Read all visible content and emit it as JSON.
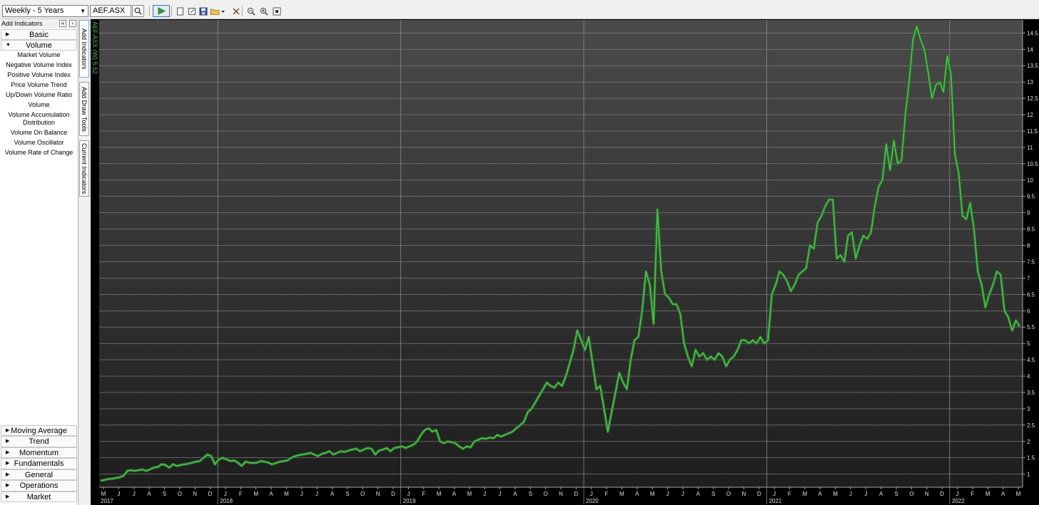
{
  "toolbar": {
    "period_value": "Weekly - 5 Years",
    "symbol_value": "AEF.ASX"
  },
  "left_panel": {
    "header": "Add Indicators",
    "collapse_label": "«",
    "close_label": "‹",
    "top_categories": [
      {
        "label": "Basic",
        "expanded": false
      },
      {
        "label": "Volume",
        "expanded": true
      }
    ],
    "volume_items": [
      "Market Volume",
      "Negative Volume Index",
      "Positive Volume Index",
      "Price Volume Trend",
      "Up/Down Volume Ratio",
      "Volume",
      "Volume Accumulation Distribution",
      "Volume On Balance",
      "Volume Oscillator",
      "Volume Rate of Change"
    ],
    "bottom_categories": [
      "Moving Average",
      "Trend",
      "Momentum",
      "Fundamentals",
      "General",
      "Operations",
      "Market"
    ]
  },
  "vertical_tabs": [
    "Add Indicators",
    "Add Draw Tools",
    "Current Indicators"
  ],
  "chart_data": {
    "type": "line",
    "series_label": "AEF.ASX (W) 5.52",
    "series": [
      {
        "name": "AEF.ASX",
        "color": "#4ec24e",
        "values": [
          0.8,
          0.82,
          0.85,
          0.86,
          0.88,
          0.9,
          0.95,
          1.1,
          1.12,
          1.1,
          1.12,
          1.14,
          1.1,
          1.15,
          1.2,
          1.22,
          1.3,
          1.28,
          1.2,
          1.3,
          1.25,
          1.28,
          1.3,
          1.32,
          1.35,
          1.38,
          1.4,
          1.5,
          1.6,
          1.55,
          1.3,
          1.45,
          1.5,
          1.45,
          1.4,
          1.42,
          1.35,
          1.25,
          1.38,
          1.35,
          1.34,
          1.35,
          1.4,
          1.38,
          1.35,
          1.3,
          1.34,
          1.38,
          1.4,
          1.42,
          1.5,
          1.55,
          1.58,
          1.6,
          1.62,
          1.65,
          1.6,
          1.55,
          1.62,
          1.65,
          1.7,
          1.6,
          1.65,
          1.7,
          1.68,
          1.72,
          1.75,
          1.78,
          1.7,
          1.75,
          1.8,
          1.78,
          1.6,
          1.72,
          1.75,
          1.8,
          1.7,
          1.8,
          1.82,
          1.85,
          1.8,
          1.85,
          1.9,
          2.0,
          2.2,
          2.35,
          2.4,
          2.3,
          2.35,
          2.0,
          1.95,
          2.0,
          1.98,
          1.95,
          1.85,
          1.78,
          1.85,
          1.82,
          2.0,
          2.05,
          2.1,
          2.08,
          2.12,
          2.1,
          2.2,
          2.15,
          2.2,
          2.25,
          2.3,
          2.4,
          2.5,
          2.6,
          2.9,
          3.0,
          3.2,
          3.4,
          3.6,
          3.8,
          3.7,
          3.65,
          3.8,
          3.7,
          4.0,
          4.4,
          4.8,
          5.4,
          5.1,
          4.8,
          5.2,
          4.4,
          3.6,
          3.7,
          3.0,
          2.3,
          2.9,
          3.5,
          4.1,
          3.8,
          3.6,
          4.5,
          5.1,
          5.2,
          6.0,
          7.2,
          6.8,
          5.6,
          9.1,
          7.2,
          6.5,
          6.4,
          6.2,
          6.2,
          5.9,
          5.0,
          4.6,
          4.3,
          4.8,
          4.6,
          4.7,
          4.5,
          4.6,
          4.5,
          4.7,
          4.6,
          4.3,
          4.5,
          4.6,
          4.8,
          5.1,
          5.1,
          5.0,
          5.1,
          5.0,
          5.2,
          5.0,
          5.1,
          6.5,
          6.8,
          7.2,
          7.1,
          6.9,
          6.6,
          6.8,
          7.1,
          7.2,
          7.3,
          8.0,
          7.9,
          8.7,
          8.9,
          9.2,
          9.4,
          9.4,
          7.6,
          7.7,
          7.5,
          8.3,
          8.4,
          7.6,
          8.0,
          8.3,
          8.2,
          8.4,
          9.2,
          9.8,
          10.0,
          11.1,
          10.3,
          11.2,
          10.5,
          10.6,
          12.0,
          13.0,
          14.3,
          14.7,
          14.3,
          14.0,
          13.3,
          12.5,
          12.9,
          13.0,
          12.7,
          13.8,
          13.2,
          10.8,
          10.2,
          8.9,
          8.8,
          9.3,
          8.5,
          7.2,
          6.8,
          6.1,
          6.5,
          6.8,
          7.2,
          7.1,
          6.0,
          5.8,
          5.4,
          5.7,
          5.52
        ]
      }
    ],
    "ylim": [
      0.6,
      14.9
    ],
    "y_ticks": [
      "1",
      "1.5",
      "2",
      "2.5",
      "3",
      "3.5",
      "4",
      "4.5",
      "5",
      "5.5",
      "6",
      "6.5",
      "7",
      "7.5",
      "8",
      "8.5",
      "9",
      "9.5",
      "10",
      "10.5",
      "11",
      "11.5",
      "12",
      "12.5",
      "13",
      "13.5",
      "14",
      "14.5"
    ],
    "x_month_labels": [
      "M",
      "J",
      "J",
      "A",
      "S",
      "O",
      "N",
      "D",
      "J",
      "F",
      "M",
      "A",
      "M",
      "J",
      "J",
      "A",
      "S",
      "O",
      "N",
      "D",
      "J",
      "F",
      "M",
      "A",
      "M",
      "J",
      "J",
      "A",
      "S",
      "O",
      "N",
      "D",
      "J",
      "F",
      "M",
      "A",
      "M",
      "J",
      "J",
      "A",
      "S",
      "O",
      "N",
      "D",
      "J",
      "F",
      "M",
      "A",
      "M",
      "J",
      "J",
      "A",
      "S",
      "O",
      "N",
      "D",
      "J",
      "F",
      "M",
      "A",
      "M"
    ],
    "x_year_labels": [
      "2017",
      "2018",
      "2019",
      "2020",
      "2021",
      "2022"
    ],
    "grid": true,
    "background": "#2f2f2f",
    "grid_color": "#8a8a8a"
  }
}
